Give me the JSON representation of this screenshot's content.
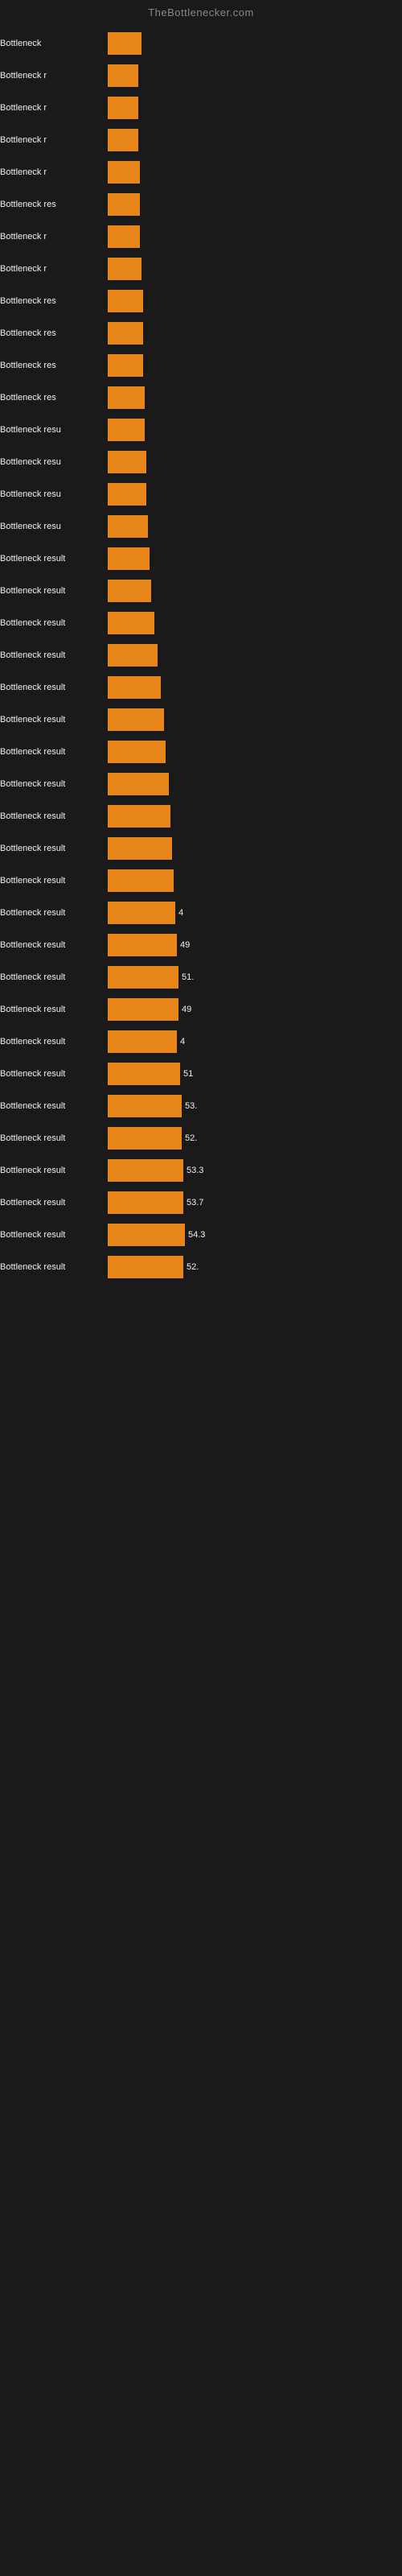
{
  "site": {
    "title": "TheBottlenecker.com"
  },
  "chart": {
    "bars": [
      {
        "label": "Bottleneck",
        "value": null,
        "width": 42
      },
      {
        "label": "Bottleneck r",
        "value": null,
        "width": 38
      },
      {
        "label": "Bottleneck r",
        "value": null,
        "width": 38
      },
      {
        "label": "Bottleneck r",
        "value": null,
        "width": 38
      },
      {
        "label": "Bottleneck r",
        "value": null,
        "width": 40
      },
      {
        "label": "Bottleneck res",
        "value": null,
        "width": 40
      },
      {
        "label": "Bottleneck r",
        "value": null,
        "width": 40
      },
      {
        "label": "Bottleneck r",
        "value": null,
        "width": 42
      },
      {
        "label": "Bottleneck res",
        "value": null,
        "width": 44
      },
      {
        "label": "Bottleneck res",
        "value": null,
        "width": 44
      },
      {
        "label": "Bottleneck res",
        "value": null,
        "width": 44
      },
      {
        "label": "Bottleneck res",
        "value": null,
        "width": 46
      },
      {
        "label": "Bottleneck resu",
        "value": null,
        "width": 46
      },
      {
        "label": "Bottleneck resu",
        "value": null,
        "width": 48
      },
      {
        "label": "Bottleneck resu",
        "value": null,
        "width": 48
      },
      {
        "label": "Bottleneck resu",
        "value": null,
        "width": 50
      },
      {
        "label": "Bottleneck result",
        "value": null,
        "width": 52
      },
      {
        "label": "Bottleneck result",
        "value": null,
        "width": 54
      },
      {
        "label": "Bottleneck result",
        "value": null,
        "width": 58
      },
      {
        "label": "Bottleneck result",
        "value": null,
        "width": 62
      },
      {
        "label": "Bottleneck result",
        "value": null,
        "width": 66
      },
      {
        "label": "Bottleneck result",
        "value": null,
        "width": 70
      },
      {
        "label": "Bottleneck result",
        "value": null,
        "width": 72
      },
      {
        "label": "Bottleneck result",
        "value": null,
        "width": 76
      },
      {
        "label": "Bottleneck result",
        "value": null,
        "width": 78
      },
      {
        "label": "Bottleneck result",
        "value": null,
        "width": 80
      },
      {
        "label": "Bottleneck result",
        "value": null,
        "width": 82
      },
      {
        "label": "Bottleneck result",
        "value": "4",
        "width": 84
      },
      {
        "label": "Bottleneck result",
        "value": "49",
        "width": 86
      },
      {
        "label": "Bottleneck result",
        "value": "51.",
        "width": 88
      },
      {
        "label": "Bottleneck result",
        "value": "49",
        "width": 88
      },
      {
        "label": "Bottleneck result",
        "value": "4",
        "width": 86
      },
      {
        "label": "Bottleneck result",
        "value": "51",
        "width": 90
      },
      {
        "label": "Bottleneck result",
        "value": "53.",
        "width": 92
      },
      {
        "label": "Bottleneck result",
        "value": "52.",
        "width": 92
      },
      {
        "label": "Bottleneck result",
        "value": "53.3",
        "width": 94
      },
      {
        "label": "Bottleneck result",
        "value": "53.7",
        "width": 94
      },
      {
        "label": "Bottleneck result",
        "value": "54.3",
        "width": 96
      },
      {
        "label": "Bottleneck result",
        "value": "52.",
        "width": 94
      }
    ]
  }
}
